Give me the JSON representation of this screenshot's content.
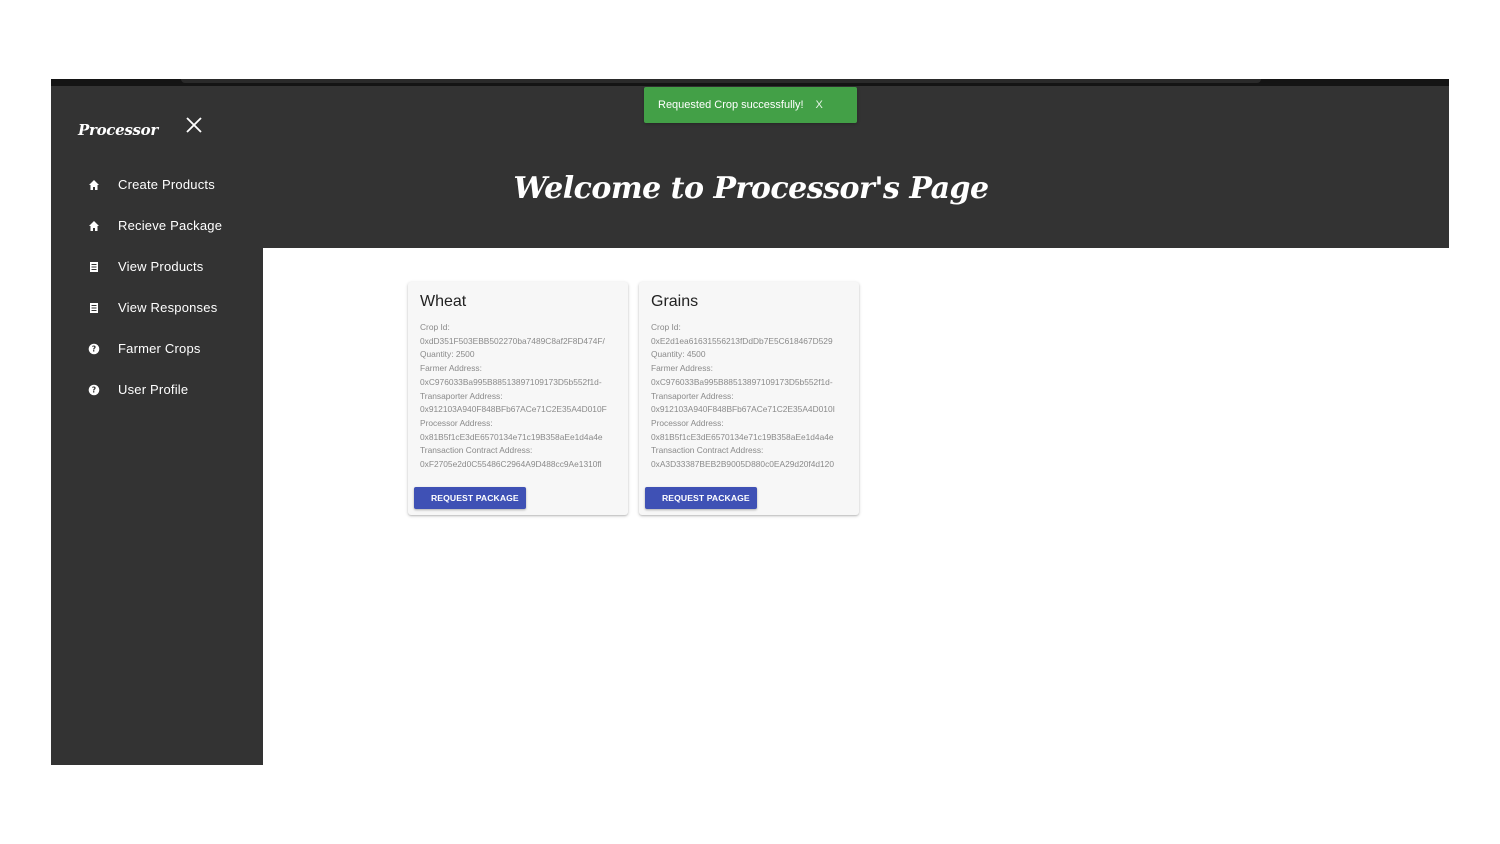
{
  "toast": {
    "message": "Requested Crop successfully!",
    "close_label": "X",
    "color": "#43a047"
  },
  "sidebar": {
    "brand": "Processor",
    "items": [
      {
        "label": "Create Products",
        "icon": "home-icon"
      },
      {
        "label": "Recieve Package",
        "icon": "home-icon"
      },
      {
        "label": "View Products",
        "icon": "list-icon"
      },
      {
        "label": "View Responses",
        "icon": "list-icon"
      },
      {
        "label": "Farmer Crops",
        "icon": "help-circle-icon"
      },
      {
        "label": "User Profile",
        "icon": "help-circle-icon"
      }
    ]
  },
  "header": {
    "title": "Welcome to Processor's Page"
  },
  "cards": [
    {
      "title": "Wheat",
      "crop_id_label": "Crop Id:",
      "crop_id": "0xdD351F503EBB502270ba7489C8af2F8D474F/",
      "quantity": "Quantity: 2500",
      "farmer_label": "Farmer Address:",
      "farmer": "0xC976033Ba995B88513897109173D5b552f1d-",
      "transporter_label": "Transaporter Address:",
      "transporter": "0x912103A940F848BFb67ACe71C2E35A4D010F",
      "processor_label": "Processor Address:",
      "processor": "0x81B5f1cE3dE6570134e71c19B358aEe1d4a4e",
      "contract_label": "Transaction Contract Address:",
      "contract": "0xF2705e2d0C55486C2964A9D488cc9Ae1310fl",
      "button": "REQUEST PACKAGE"
    },
    {
      "title": "Grains",
      "crop_id_label": "Crop Id:",
      "crop_id": "0xE2d1ea61631556213fDdDb7E5C618467D529",
      "quantity": "Quantity: 4500",
      "farmer_label": "Farmer Address:",
      "farmer": "0xC976033Ba995B88513897109173D5b552f1d-",
      "transporter_label": "Transaporter Address:",
      "transporter": "0x912103A940F848BFb67ACe71C2E35A4D010I",
      "processor_label": "Processor Address:",
      "processor": "0x81B5f1cE3dE6570134e71c19B358aEe1d4a4e",
      "contract_label": "Transaction Contract Address:",
      "contract": "0xA3D33387BEB2B9005D880c0EA29d20f4d120",
      "button": "REQUEST PACKAGE"
    }
  ],
  "colors": {
    "dark": "#333333",
    "button": "#3f51b5",
    "card": "#f7f7f7"
  }
}
